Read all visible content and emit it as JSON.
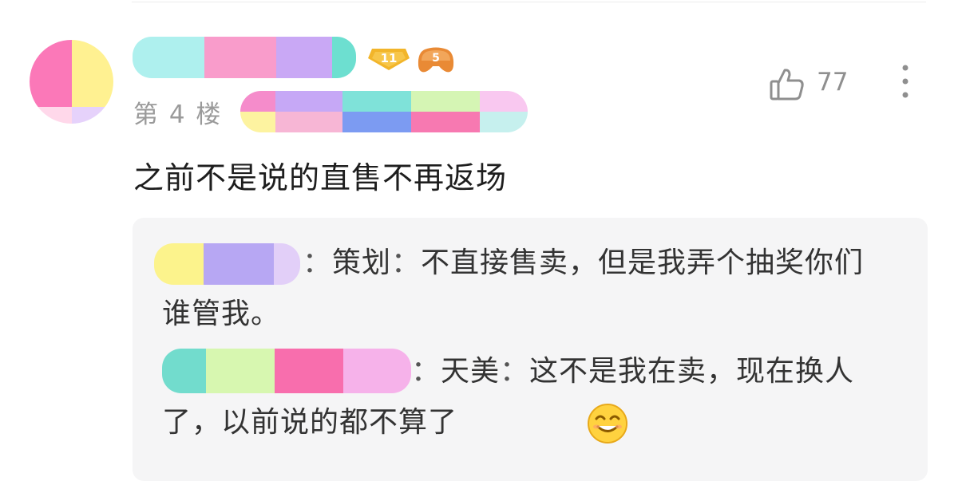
{
  "comment": {
    "floor": "第 4 楼",
    "text": "之前不是说的直售不再返场",
    "like_count": "77",
    "badges": {
      "level": "11",
      "game_level": "5"
    }
  },
  "replies": [
    {
      "speaker": "策划",
      "text": "不直接售卖，但是我弄个抽奖你们谁管我。"
    },
    {
      "speaker": "天美",
      "text": "这不是我在卖，现在换人了，以前说的都不算了"
    }
  ],
  "colors": {
    "background": "#ffffff",
    "reply_background": "#f5f5f6",
    "muted_text": "#9a9a9a",
    "level_badge": "#f2b52a",
    "game_badge": "#e98a35"
  },
  "icons": [
    "thumbs-up-icon",
    "more-vertical-icon",
    "smile-emoji-icon"
  ]
}
